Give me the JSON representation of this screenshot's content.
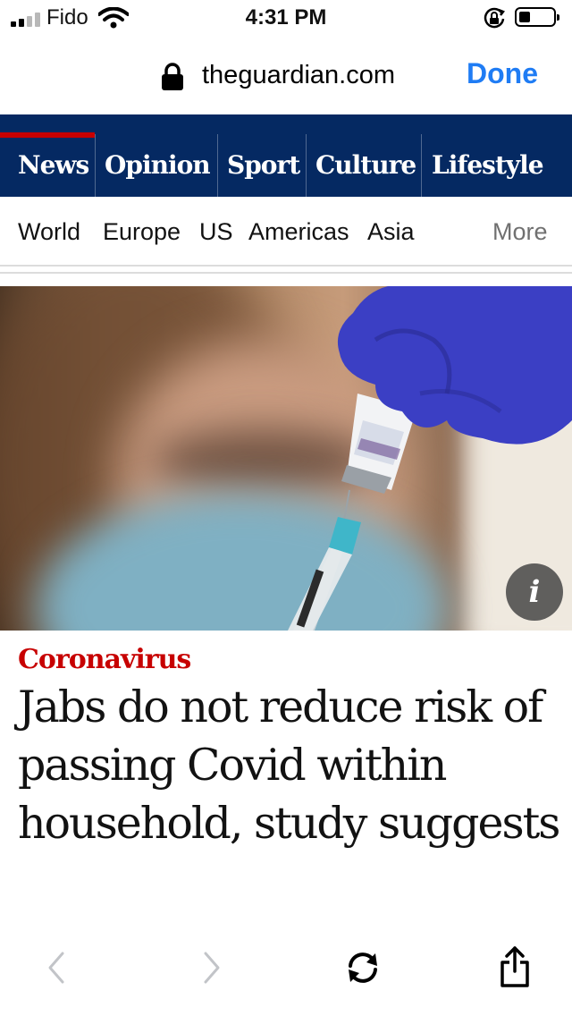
{
  "status_bar": {
    "carrier": "Fido",
    "time": "4:31 PM"
  },
  "address_bar": {
    "domain": "theguardian.com",
    "done_label": "Done"
  },
  "pillars": [
    "News",
    "Opinion",
    "Sport",
    "Culture",
    "Lifestyle"
  ],
  "subnav": {
    "items": [
      "World",
      "Europe",
      "US",
      "Americas",
      "Asia"
    ],
    "more_label": "More"
  },
  "article": {
    "kicker": "Coronavirus",
    "headline": "Jabs do not reduce risk of passing Covid within household, study suggests",
    "image_info_label": "i"
  },
  "colors": {
    "guardian_blue": "#052962",
    "red": "#c70000",
    "ios_blue": "#1f7cf4"
  },
  "icons": [
    "signal-icon",
    "wifi-icon",
    "orientation-lock-icon",
    "battery-icon",
    "padlock-icon",
    "back-icon",
    "forward-icon",
    "reload-icon",
    "share-icon",
    "info-icon"
  ]
}
